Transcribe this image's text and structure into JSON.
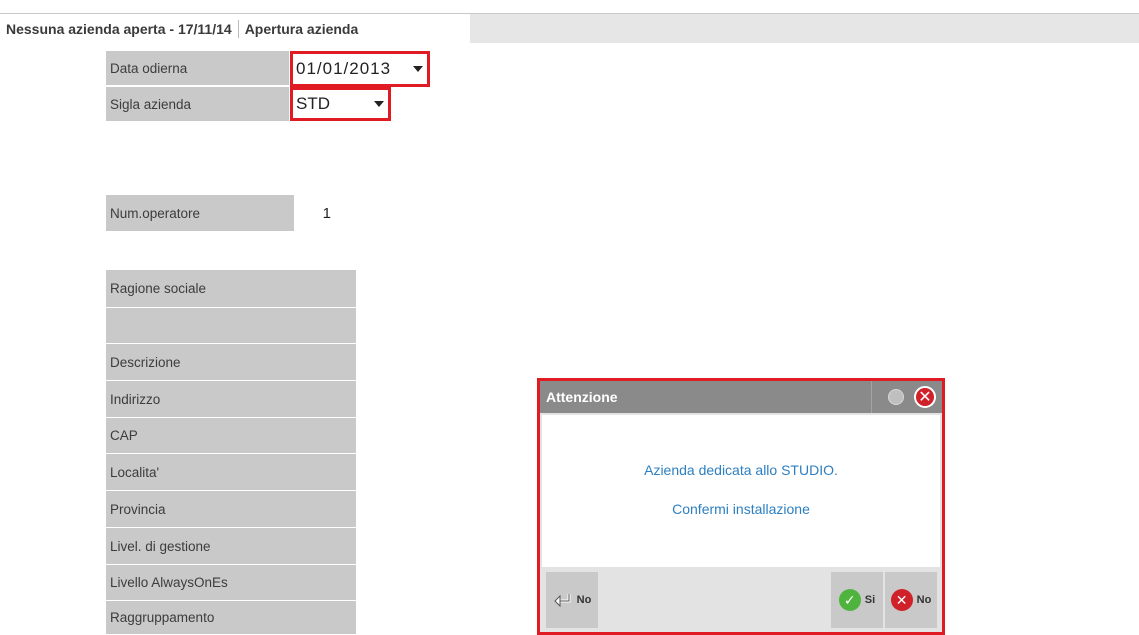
{
  "tabs": {
    "context": "Nessuna azienda aperta - 17/11/14",
    "active": "Apertura azienda"
  },
  "fields": {
    "data_odierna": {
      "label": "Data odierna",
      "value": "01/01/2013"
    },
    "sigla_azienda": {
      "label": "Sigla azienda",
      "value": "STD"
    },
    "num_operatore": {
      "label": "Num.operatore",
      "value": "1"
    }
  },
  "company_labels": [
    "Ragione sociale",
    "",
    "Descrizione",
    "Indirizzo",
    "CAP",
    "Localita'",
    "Provincia",
    "Livel. di gestione",
    "Livello AlwaysOnEs",
    "Raggruppamento"
  ],
  "dialog": {
    "title": "Attenzione",
    "message_line1": "Azienda dedicata allo STUDIO.",
    "message_line2": "Confermi installazione",
    "left_button": "No",
    "yes_button": "Si",
    "no_button": "No"
  },
  "colors": {
    "highlight": "#e01b24",
    "message": "#2d7fc1"
  }
}
